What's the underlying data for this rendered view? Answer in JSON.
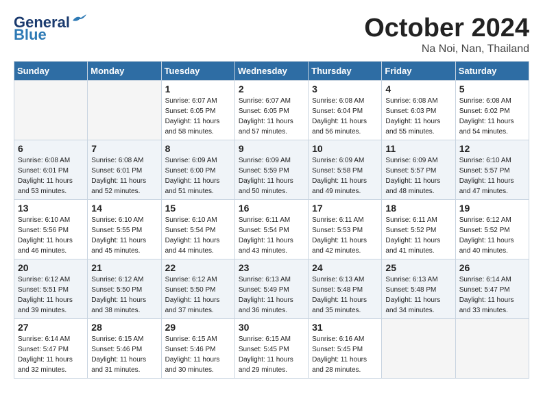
{
  "header": {
    "logo_line1": "General",
    "logo_line2": "Blue",
    "month": "October 2024",
    "location": "Na Noi, Nan, Thailand"
  },
  "weekdays": [
    "Sunday",
    "Monday",
    "Tuesday",
    "Wednesday",
    "Thursday",
    "Friday",
    "Saturday"
  ],
  "weeks": [
    [
      {
        "day": "",
        "empty": true
      },
      {
        "day": "",
        "empty": true
      },
      {
        "day": "1",
        "sunrise": "6:07 AM",
        "sunset": "6:05 PM",
        "daylight": "11 hours and 58 minutes."
      },
      {
        "day": "2",
        "sunrise": "6:07 AM",
        "sunset": "6:05 PM",
        "daylight": "11 hours and 57 minutes."
      },
      {
        "day": "3",
        "sunrise": "6:08 AM",
        "sunset": "6:04 PM",
        "daylight": "11 hours and 56 minutes."
      },
      {
        "day": "4",
        "sunrise": "6:08 AM",
        "sunset": "6:03 PM",
        "daylight": "11 hours and 55 minutes."
      },
      {
        "day": "5",
        "sunrise": "6:08 AM",
        "sunset": "6:02 PM",
        "daylight": "11 hours and 54 minutes."
      }
    ],
    [
      {
        "day": "6",
        "sunrise": "6:08 AM",
        "sunset": "6:01 PM",
        "daylight": "11 hours and 53 minutes."
      },
      {
        "day": "7",
        "sunrise": "6:08 AM",
        "sunset": "6:01 PM",
        "daylight": "11 hours and 52 minutes."
      },
      {
        "day": "8",
        "sunrise": "6:09 AM",
        "sunset": "6:00 PM",
        "daylight": "11 hours and 51 minutes."
      },
      {
        "day": "9",
        "sunrise": "6:09 AM",
        "sunset": "5:59 PM",
        "daylight": "11 hours and 50 minutes."
      },
      {
        "day": "10",
        "sunrise": "6:09 AM",
        "sunset": "5:58 PM",
        "daylight": "11 hours and 49 minutes."
      },
      {
        "day": "11",
        "sunrise": "6:09 AM",
        "sunset": "5:57 PM",
        "daylight": "11 hours and 48 minutes."
      },
      {
        "day": "12",
        "sunrise": "6:10 AM",
        "sunset": "5:57 PM",
        "daylight": "11 hours and 47 minutes."
      }
    ],
    [
      {
        "day": "13",
        "sunrise": "6:10 AM",
        "sunset": "5:56 PM",
        "daylight": "11 hours and 46 minutes."
      },
      {
        "day": "14",
        "sunrise": "6:10 AM",
        "sunset": "5:55 PM",
        "daylight": "11 hours and 45 minutes."
      },
      {
        "day": "15",
        "sunrise": "6:10 AM",
        "sunset": "5:54 PM",
        "daylight": "11 hours and 44 minutes."
      },
      {
        "day": "16",
        "sunrise": "6:11 AM",
        "sunset": "5:54 PM",
        "daylight": "11 hours and 43 minutes."
      },
      {
        "day": "17",
        "sunrise": "6:11 AM",
        "sunset": "5:53 PM",
        "daylight": "11 hours and 42 minutes."
      },
      {
        "day": "18",
        "sunrise": "6:11 AM",
        "sunset": "5:52 PM",
        "daylight": "11 hours and 41 minutes."
      },
      {
        "day": "19",
        "sunrise": "6:12 AM",
        "sunset": "5:52 PM",
        "daylight": "11 hours and 40 minutes."
      }
    ],
    [
      {
        "day": "20",
        "sunrise": "6:12 AM",
        "sunset": "5:51 PM",
        "daylight": "11 hours and 39 minutes."
      },
      {
        "day": "21",
        "sunrise": "6:12 AM",
        "sunset": "5:50 PM",
        "daylight": "11 hours and 38 minutes."
      },
      {
        "day": "22",
        "sunrise": "6:12 AM",
        "sunset": "5:50 PM",
        "daylight": "11 hours and 37 minutes."
      },
      {
        "day": "23",
        "sunrise": "6:13 AM",
        "sunset": "5:49 PM",
        "daylight": "11 hours and 36 minutes."
      },
      {
        "day": "24",
        "sunrise": "6:13 AM",
        "sunset": "5:48 PM",
        "daylight": "11 hours and 35 minutes."
      },
      {
        "day": "25",
        "sunrise": "6:13 AM",
        "sunset": "5:48 PM",
        "daylight": "11 hours and 34 minutes."
      },
      {
        "day": "26",
        "sunrise": "6:14 AM",
        "sunset": "5:47 PM",
        "daylight": "11 hours and 33 minutes."
      }
    ],
    [
      {
        "day": "27",
        "sunrise": "6:14 AM",
        "sunset": "5:47 PM",
        "daylight": "11 hours and 32 minutes."
      },
      {
        "day": "28",
        "sunrise": "6:15 AM",
        "sunset": "5:46 PM",
        "daylight": "11 hours and 31 minutes."
      },
      {
        "day": "29",
        "sunrise": "6:15 AM",
        "sunset": "5:46 PM",
        "daylight": "11 hours and 30 minutes."
      },
      {
        "day": "30",
        "sunrise": "6:15 AM",
        "sunset": "5:45 PM",
        "daylight": "11 hours and 29 minutes."
      },
      {
        "day": "31",
        "sunrise": "6:16 AM",
        "sunset": "5:45 PM",
        "daylight": "11 hours and 28 minutes."
      },
      {
        "day": "",
        "empty": true
      },
      {
        "day": "",
        "empty": true
      }
    ]
  ]
}
